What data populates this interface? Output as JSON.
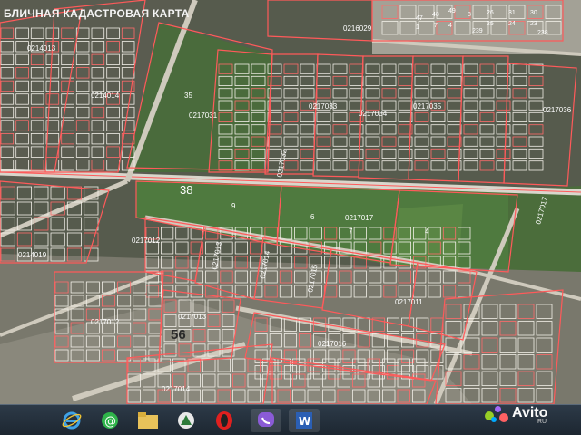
{
  "map": {
    "title": "БЛИЧНАЯ КАДАСТРОВАЯ КАРТА",
    "road_number": "38",
    "area_number": "56",
    "block_labels": [
      "0216029",
      "0214013",
      "0214014",
      "0217031",
      "0217032",
      "0217033",
      "0217034",
      "0217035",
      "0217036",
      "0217017",
      "0217017",
      "0214019",
      "0217012",
      "0217013",
      "0217014",
      "0217011",
      "0217015",
      "0217016",
      "0217012",
      "0217013",
      "0217014"
    ],
    "field_numbers": [
      "9",
      "6",
      "7",
      "4",
      "35"
    ],
    "top_right_numbers": [
      "47",
      "48",
      "49",
      "1",
      "7",
      "4",
      "8",
      "26",
      "31",
      "30",
      "25",
      "24",
      "23",
      "239",
      "238"
    ],
    "colors": {
      "boundary": "#ff5a5a",
      "field": "#4f7a3f",
      "road": "#b8b6ac",
      "soil": "#6f6c5e"
    }
  },
  "taskbar": {
    "icons": [
      "internet-explorer-icon",
      "browser-at-icon",
      "file-explorer-icon",
      "media-player-icon",
      "opera-icon",
      "viber-icon",
      "word-icon"
    ]
  },
  "watermark": {
    "text": "Avito",
    "sub": "RU"
  }
}
